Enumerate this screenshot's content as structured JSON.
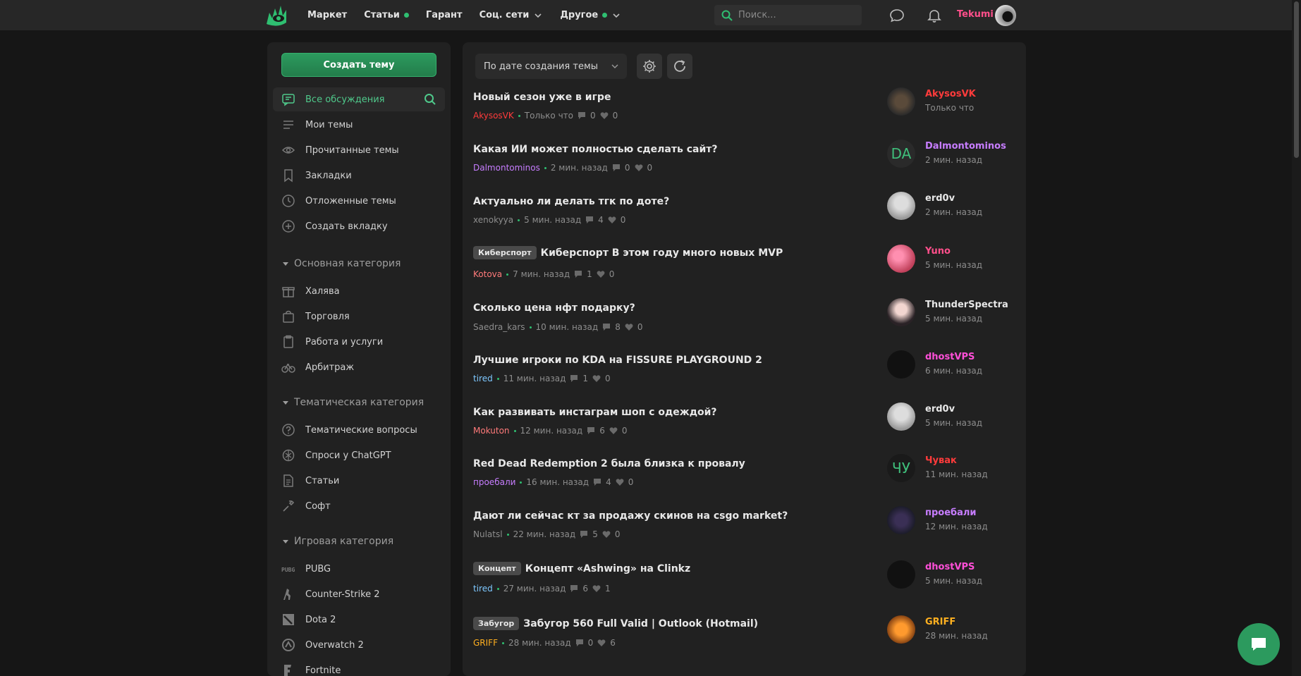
{
  "colors": {
    "accent": "#2c9a5e",
    "accent_light": "#4fc98b",
    "bg": "#161616",
    "panel": "#212121",
    "username": "#ff4f8b"
  },
  "nav": {
    "items": [
      {
        "label": "Маркет",
        "dot": false,
        "dropdown": false
      },
      {
        "label": "Статьи",
        "dot": true,
        "dropdown": false
      },
      {
        "label": "Гарант",
        "dot": false,
        "dropdown": false
      },
      {
        "label": "Соц. сети",
        "dot": false,
        "dropdown": true
      },
      {
        "label": "Другое",
        "dot": true,
        "dropdown": true
      }
    ],
    "search_placeholder": "Поиск...",
    "username": "Tekumi"
  },
  "sidebar": {
    "create_label": "Создать тему",
    "items": [
      {
        "label": "Все обсуждения",
        "icon": "chat-icon"
      },
      {
        "label": "Мои темы",
        "icon": "lines-icon"
      },
      {
        "label": "Прочитанные темы",
        "icon": "eye-icon"
      },
      {
        "label": "Закладки",
        "icon": "bookmark-icon"
      },
      {
        "label": "Отложенные темы",
        "icon": "clock-icon"
      },
      {
        "label": "Создать вкладку",
        "icon": "plus-circle-icon"
      }
    ],
    "categories": [
      {
        "title": "Основная категория",
        "items": [
          {
            "label": "Халява",
            "icon": "gift-icon"
          },
          {
            "label": "Торговля",
            "icon": "bag-icon"
          },
          {
            "label": "Работа и услуги",
            "icon": "clipboard-icon"
          },
          {
            "label": "Арбитраж",
            "icon": "bicycle-icon"
          }
        ]
      },
      {
        "title": "Тематическая категория",
        "items": [
          {
            "label": "Тематические вопросы",
            "icon": "question-icon"
          },
          {
            "label": "Спроси у ChatGPT",
            "icon": "openai-icon"
          },
          {
            "label": "Статьи",
            "icon": "document-icon"
          },
          {
            "label": "Софт",
            "icon": "wrench-icon"
          }
        ]
      },
      {
        "title": "Игровая категория",
        "items": [
          {
            "label": "PUBG",
            "icon": "pubg-icon"
          },
          {
            "label": "Counter-Strike 2",
            "icon": "cs-icon"
          },
          {
            "label": "Dota 2",
            "icon": "dota-icon"
          },
          {
            "label": "Overwatch 2",
            "icon": "overwatch-icon"
          },
          {
            "label": "Fortnite",
            "icon": "fortnite-icon"
          }
        ]
      }
    ]
  },
  "main": {
    "sort_label": "По дате создания темы",
    "threads": [
      {
        "prefix": "",
        "title": "Новый сезон уже в игре",
        "author": "AkysosVK",
        "author_color": "#ff3b3b",
        "time": "Только что",
        "replies": "0",
        "likes": "0",
        "last_user": "AkysosVK",
        "last_color": "#ff3b3b",
        "last_time": "Только что",
        "last_initials": ""
      },
      {
        "prefix": "",
        "title": "Какая ИИ может полностью сделать сайт?",
        "author": "Dalmontominos",
        "author_color": "#c77dff",
        "time": "2 мин. назад",
        "replies": "0",
        "likes": "0",
        "last_user": "Dalmontominos",
        "last_color": "#c77dff",
        "last_time": "2 мин. назад",
        "last_initials": "DA"
      },
      {
        "prefix": "",
        "title": "Актуально ли делать тгк по доте?",
        "author": "xenokyya",
        "author_color": "#8d8d8d",
        "time": "5 мин. назад",
        "replies": "4",
        "likes": "0",
        "last_user": "erd0v",
        "last_color": "#e8e8e8",
        "last_time": "2 мин. назад",
        "last_initials": ""
      },
      {
        "prefix": "Киберспорт",
        "title": "Киберспорт В этом году много новых MVP",
        "author": "Kotova",
        "author_color": "#ff7a7a",
        "time": "7 мин. назад",
        "replies": "1",
        "likes": "0",
        "last_user": "Yuno",
        "last_color": "#ff4f8b",
        "last_time": "5 мин. назад",
        "last_initials": ""
      },
      {
        "prefix": "",
        "title": "Сколько цена нфт подарку?",
        "author": "Saedra_kars",
        "author_color": "#8d8d8d",
        "time": "10 мин. назад",
        "replies": "8",
        "likes": "0",
        "last_user": "ThunderSpectra",
        "last_color": "#e8e8e8",
        "last_time": "5 мин. назад",
        "last_initials": ""
      },
      {
        "prefix": "",
        "title": "Лучшие игроки по KDA на FISSURE PLAYGROUND 2",
        "author": "tired",
        "author_color": "#7ec8ff",
        "time": "11 мин. назад",
        "replies": "1",
        "likes": "0",
        "last_user": "dhostVPS",
        "last_color": "#ff4fd8",
        "last_time": "6 мин. назад",
        "last_initials": ""
      },
      {
        "prefix": "",
        "title": "Как развивать инстаграм шоп с одеждой?",
        "author": "Mokuton",
        "author_color": "#ff7a7a",
        "time": "12 мин. назад",
        "replies": "6",
        "likes": "0",
        "last_user": "erd0v",
        "last_color": "#e8e8e8",
        "last_time": "5 мин. назад",
        "last_initials": ""
      },
      {
        "prefix": "",
        "title": "Red Dead Redemption 2 была близка к провалу",
        "author": "проебали",
        "author_color": "#c77dff",
        "time": "16 мин. назад",
        "replies": "4",
        "likes": "0",
        "last_user": "Чувак",
        "last_color": "#ff3b3b",
        "last_time": "11 мин. назад",
        "last_initials": "ЧУ"
      },
      {
        "prefix": "",
        "title": "Дают ли сейчас кт за продажу скинов на csgo market?",
        "author": "Nulatsl",
        "author_color": "#8d8d8d",
        "time": "22 мин. назад",
        "replies": "5",
        "likes": "0",
        "last_user": "проебали",
        "last_color": "#c77dff",
        "last_time": "12 мин. назад",
        "last_initials": ""
      },
      {
        "prefix": "Концепт",
        "title": "Концепт «Ashwing» на Clinkz",
        "author": "tired",
        "author_color": "#7ec8ff",
        "time": "27 мин. назад",
        "replies": "6",
        "likes": "1",
        "last_user": "dhostVPS",
        "last_color": "#ff4fd8",
        "last_time": "5 мин. назад",
        "last_initials": ""
      },
      {
        "prefix": "Забугор",
        "title": "Забугор 560 Full Valid | Outlook (Hotmail)",
        "author": "GRIFF",
        "author_color": "#ffb020",
        "time": "28 мин. назад",
        "replies": "0",
        "likes": "6",
        "last_user": "GRIFF",
        "last_color": "#ffb020",
        "last_time": "28 мин. назад",
        "last_initials": ""
      }
    ]
  }
}
